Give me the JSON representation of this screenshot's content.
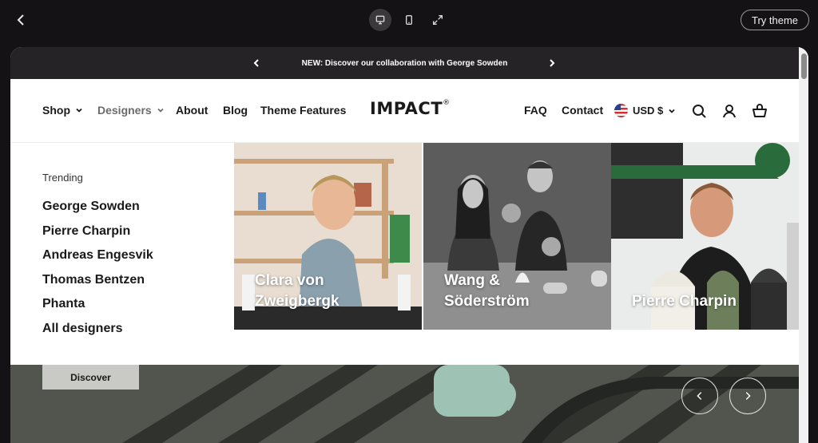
{
  "toolbar": {
    "back_icon": "chevron-left-icon",
    "devices": [
      "desktop-icon",
      "mobile-icon",
      "fullscreen-icon"
    ],
    "try_label": "Try theme"
  },
  "announcement": {
    "text": "NEW: Discover our collaboration with George Sowden"
  },
  "nav": {
    "left": [
      {
        "label": "Shop",
        "dropdown": true
      },
      {
        "label": "Designers",
        "dropdown": true,
        "active": true
      },
      {
        "label": "About"
      },
      {
        "label": "Blog"
      },
      {
        "label": "Theme Features"
      }
    ],
    "logo": "IMPACT",
    "logo_mark": "®",
    "right": {
      "faq": "FAQ",
      "contact": "Contact",
      "currency": "USD $"
    }
  },
  "mega_menu": {
    "trending_label": "Trending",
    "designers": [
      "George Sowden",
      "Pierre Charpin",
      "Andreas Engesvik",
      "Thomas Bentzen",
      "Phanta",
      "All designers"
    ],
    "cards": [
      {
        "line1": "Clara von",
        "line2": "Zweigbergk"
      },
      {
        "line1": "Wang &",
        "line2": "Söderström"
      },
      {
        "line1": "Pierre Charpin",
        "line2": ""
      }
    ]
  },
  "hero": {
    "button": "Discover"
  },
  "colors": {
    "announcement_bg": "#252325",
    "page_bg": "#141214",
    "text": "#1a1a1a",
    "muted": "#6b6b6b"
  }
}
